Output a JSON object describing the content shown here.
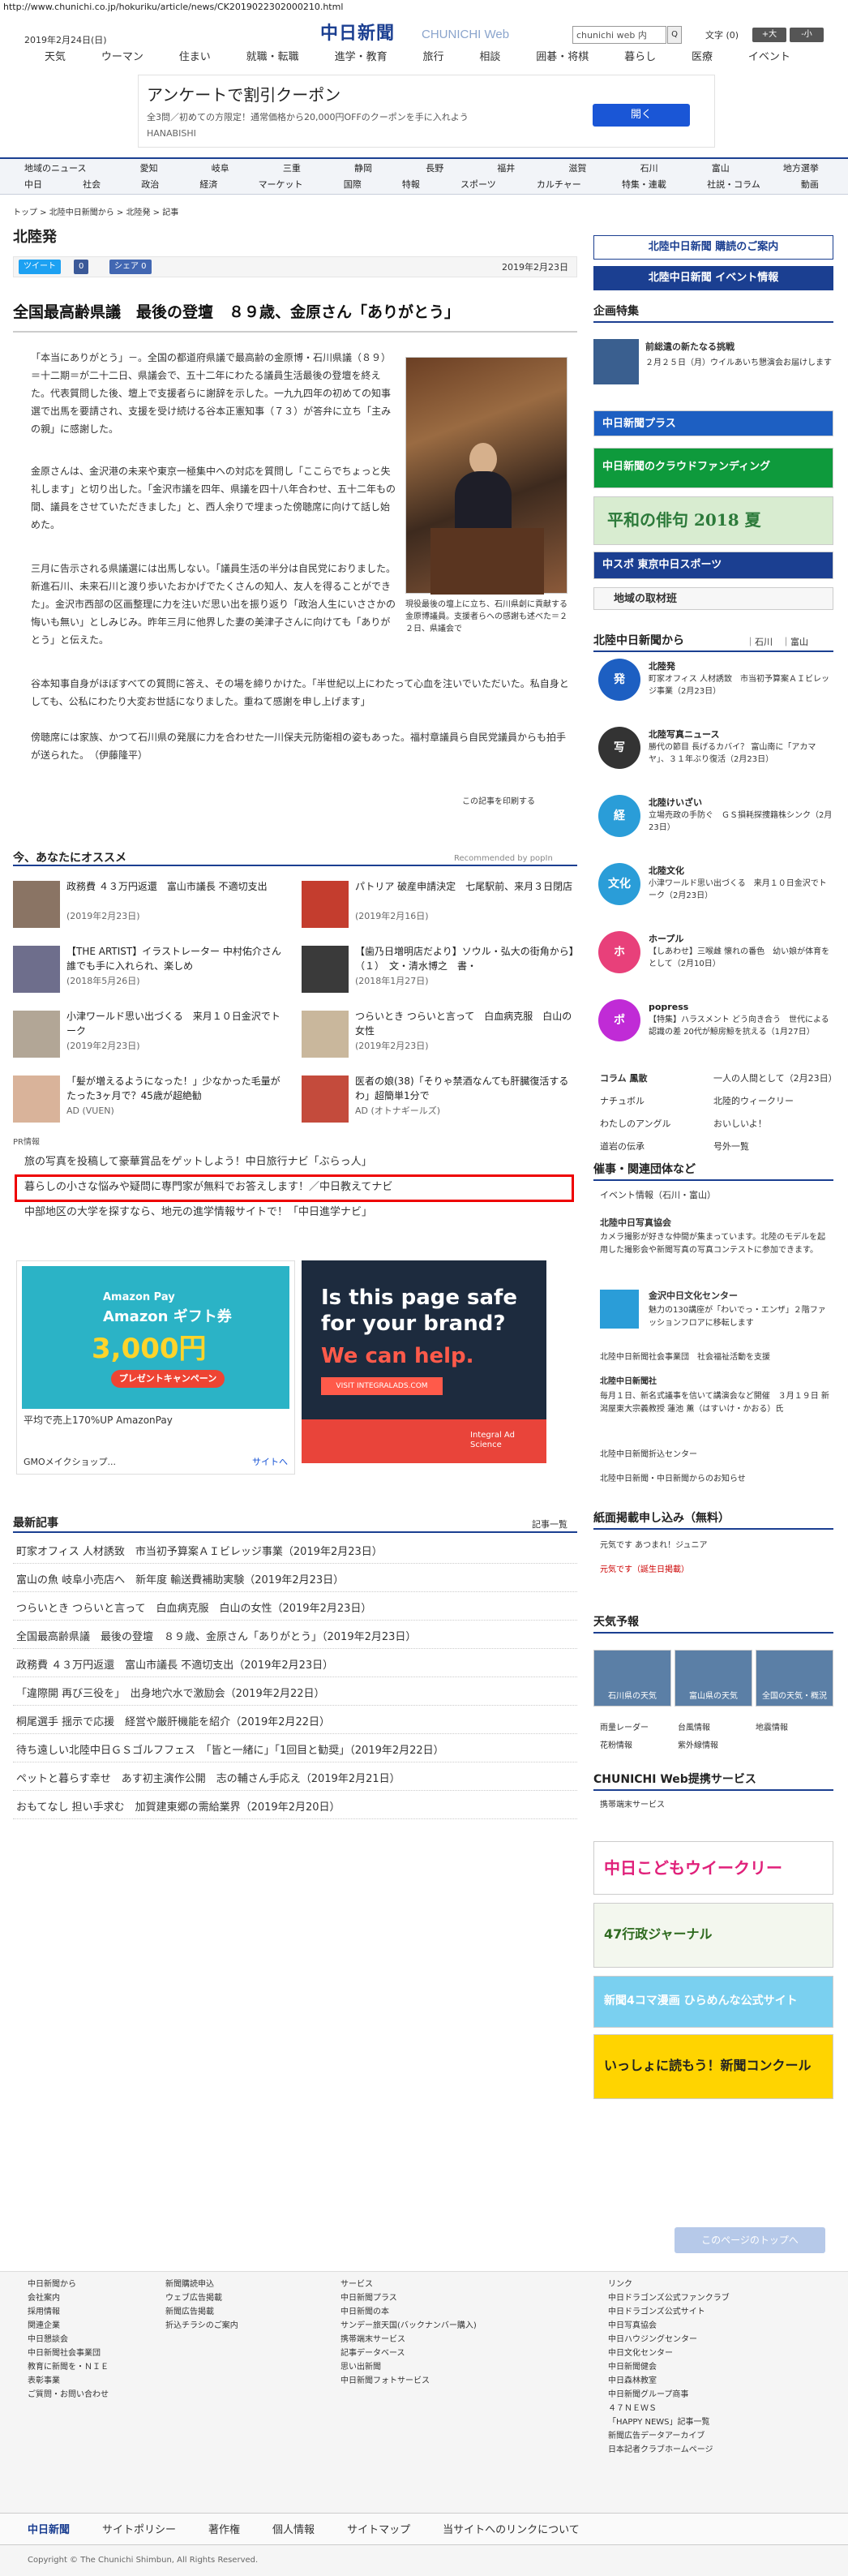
{
  "url": "http://www.chunichi.co.jp/hokuriku/article/news/CK2019022302000210.html",
  "header": {
    "date": "2019年2月24日(日)",
    "logo": "中日新聞",
    "logo_sub": "CHUNICHI Web",
    "search_placeholder": "chunichi web 内",
    "search_btn": "Q",
    "font_label": "文字 (0)",
    "font_up": "+大",
    "font_down": "-小"
  },
  "topnav": [
    "天気",
    "ウーマン",
    "住まい",
    "就職・転職",
    "進学・教育",
    "旅行",
    "相談",
    "囲碁・将棋",
    "暮らし",
    "医療",
    "イベント"
  ],
  "ad_top": {
    "title": "アンケートで割引クーポン",
    "sub": "全3問／初めての方限定！通常価格から20,000円OFFのクーポンを手に入れよう",
    "advertiser": "HANABISHI",
    "button": "開く"
  },
  "catnav_row1": [
    "地域のニュース",
    "愛知",
    "岐阜",
    "三重",
    "静岡",
    "長野",
    "福井",
    "滋賀",
    "石川",
    "富山",
    "地方選挙"
  ],
  "catnav_row2": [
    "中日",
    "社会",
    "政治",
    "経済",
    "マーケット",
    "国際",
    "特報",
    "スポーツ",
    "カルチャー",
    "特集・連載",
    "社説・コラム",
    "動画"
  ],
  "breadcrumb": "トップ > 北陸中日新聞から > 北陸発 > 記事",
  "region_title": "北陸発",
  "share": {
    "tweet": "ツイート",
    "like": "0",
    "share": "シェア 0"
  },
  "article": {
    "date": "2019年2月23日",
    "headline": "全国最高齢県議　最後の登壇　８９歳、金原さん「ありがとう」",
    "p1": "「本当にありがとう」－。全国の都道府県議で最高齢の金原博・石川県議（８９）＝十二期＝が二十二日、県議会で、五十二年にわたる議員生活最後の登壇を終えた。代表質問した後、壇上で支援者らに謝辞を示した。一九九四年の初めての知事選で出馬を要請され、支援を受け続ける谷本正憲知事（７３）が答弁に立ち「主みの親」に感謝した。",
    "p2": "金原さんは、金沢港の未来や東京一極集中への対応を質問し「ここらでちょっと失礼します」と切り出した。「金沢市議を四年、県議を四十八年合わせ、五十二年もの間、議員をさせていただきました」と、西人余りで埋まった傍聴席に向けて話し始めた。",
    "p3": "三月に告示される県議選には出馬しない。「議員生活の半分は自民党におりました。新進石川、未来石川と渡り歩いたおかげでたくさんの知人、友人を得ることができた」。金沢市西部の区画整理に力を注いだ思い出を振り返り「政治人生にいささかの悔いも無い」としみじみ。昨年三月に他界した妻の美津子さんに向けても「ありがとう」と伝えた。",
    "p4": "谷本知事自身がほぼすべての質問に答え、その場を締りかけた。「半世紀以上にわたって心血を注いでいただいた。私自身としても、公私にわたり大変お世話になりました。重ねて感謝を申し上げます」",
    "p5": "傍聴席には家族、かつて石川県の発展に力を合わせた一川保夫元防衛相の姿もあった。福村章議員ら自民党議員からも拍手が送られた。　（伊藤隆平）",
    "caption": "現役最後の壇上に立ち、石川県創に貢献する金原博議員。支援者らへの感謝も述べた＝２２日、県議会で",
    "print": "この記事を印刷する"
  },
  "recommend": {
    "title": "今、あなたにオススメ",
    "by": "Recommended by popIn",
    "items": [
      {
        "t": "政務費 ４３万円返還　富山市議長 不適切支出",
        "d": "(2019年2月23日)"
      },
      {
        "t": "パトリア 破産申請決定　七尾駅前、来月３日閉店",
        "d": "(2019年2月16日)"
      },
      {
        "t": "【THE ARTIST】イラストレーター 中村佑介さん　誰でも手に入れられ、楽しめ",
        "d": "(2018年5月26日)"
      },
      {
        "t": "【歯乃日増明店だより】ソウル・弘大の街角から】（１）　文・清水博之　書・",
        "d": "(2018年1月27日)"
      },
      {
        "t": "小津ワールド思い出づくる　来月１０日金沢でトーク",
        "d": "(2019年2月23日)"
      },
      {
        "t": "つらいとき つらいと言って　白血病克服　白山の女性",
        "d": "(2019年2月23日)"
      },
      {
        "t": "「髪が増えるようになった！」少なかった毛量がたった3ヶ月で？45歳が超絶勧",
        "d": "AD (VUEN)"
      },
      {
        "t": "医者の娘(38)「そりゃ禁酒なんても肝臓復活するわ」超簡単1分で",
        "d": "AD (オトナギールズ)"
      }
    ]
  },
  "pr": {
    "label": "PR情報",
    "links": [
      "旅の写真を投稿して豪華賞品をゲットしよう！中日旅行ナビ「ぶらっ人」",
      "暮らしの小さな悩みや疑問に専門家が無料でお答えします！／中日教えてナビ",
      "中部地区の大学を探すなら、地元の進学情報サイトで！「中日進学ナビ」"
    ]
  },
  "ad_amazon": {
    "amz": "Amazon Pay",
    "gift": "Amazon ギフト券",
    "amount": "3,000円",
    "cta": "プレゼントキャンペーン",
    "sub": "平均で売上170%UP AmazonPay",
    "gmo": "GMOメイクショップ...",
    "site": "サイトへ"
  },
  "ad_ias": {
    "l1a": "Is this page safe",
    "l1b": "for your brand?",
    "l2": "We can help.",
    "btn": "VISIT INTEGRALADS.COM",
    "brand": "Integral Ad Science"
  },
  "latest": {
    "title": "最新記事",
    "all": "記事一覧",
    "items": [
      "町家オフィス 人材誘致　市当初予算案ＡＩビレッジ事業（2019年2月23日）",
      "富山の魚 岐阜小売店へ　新年度 輸送費補助実験（2019年2月23日）",
      "つらいとき つらいと言って　白血病克服　白山の女性（2019年2月23日）",
      "全国最高齢県議　最後の登壇　８９歳、金原さん「ありがとう」（2019年2月23日）",
      "政務費 ４３万円返還　富山市議長 不適切支出（2019年2月23日）",
      "「違際開 再び三役を」　出身地穴水で激励会（2019年2月22日）",
      "桐尾選手 揺示で応援　経営や厳肝機能を紹介（2019年2月22日）",
      "待ち遠しい北陸中日ＧＳゴルフフェス　「皆と一緒に」「1回目と勧奨」（2019年2月22日）",
      "ペットと暮らす幸せ　あす初主演作公開　志の輔さん手応え（2019年2月21日）",
      "おもてなし 担い手求む　加賀建東郷の需給業界（2019年2月20日）"
    ]
  },
  "sidebar": {
    "subscribe": "北陸中日新聞 購読のご案内",
    "event": "北陸中日新聞 イベント情報",
    "kikaku": "企画特集",
    "feature_t": "前総遺の新たなる挑戦",
    "feature_d": "２月２５日（月）ウイルあいち懇演会お届けします",
    "ban1": "中日新聞プラス",
    "ban2": "中日新聞のクラウドファンディング",
    "ban3": "平和の俳句 2018 夏",
    "ban4": "中スポ 東京中日スポーツ",
    "region_link": "地域の取材班",
    "hk_title": "北陸中日新聞から",
    "hk_tabs": "｜石川　｜富山",
    "entries": [
      {
        "icon": "発",
        "t": "北陸発",
        "d": "町家オフィス 人材誘致　市当初予算案ＡＩビレッジ事業（2月23日）"
      },
      {
        "icon": "写",
        "t": "北陸写真ニュース",
        "d": "勝代の節目 長げるカバイ？ 富山南に「アカマヤ」、３１年ぶり復活（2月23日）"
      },
      {
        "icon": "経",
        "t": "北陸けいざい",
        "d": "立場売政の手防ぐ　ＧＳ損耗探捜籍株シンク（2月23日）"
      },
      {
        "icon": "文化",
        "t": "北陸文化",
        "d": "小津ワールド思い出づくる　来月１０日金沢でトーク（2月23日）"
      },
      {
        "icon": "ホ",
        "t": "ホープル",
        "d": "【しあわせ】三喉雌 懐れの番色　幼い娘が体育をとして（2月10日）"
      },
      {
        "icon": "ポ",
        "t": "popress",
        "d": "【特集】ハラスメント どう向き合う　世代による認識の差 20代が鯨房鯨を抗える（1月27日）"
      }
    ],
    "links": [
      "コラム 鳳散",
      "一人の人間として（2月23日）",
      "ナチュボル",
      "北陸的ウィークリー",
      "わたしのアングル",
      "おいしいよ！",
      "道岩の伝承",
      "号外一覧"
    ],
    "saiji": "催事・関連団体など",
    "ev_link": "イベント情報（石川・富山）",
    "photo_t": "北陸中日写真協会",
    "photo_d": "カメラ撮影が好きな仲間が集まっています。北陸のモデルを起用した撮影会や新聞写真の写真コンテストに参加できます。",
    "kanazawa_t": "金沢中日文化センター",
    "kanazawa_d": "魅力の130講座が「わいでっ・エンザ」２階ファッションフロアに移転します",
    "soc1": "北陸中日新聞社会事業団　社会福祉活動を支援",
    "fuku_t": "北陸中日新聞社",
    "fuku_d": "毎月１日、新名式議事を信いて講演会など開催　３月１９日 新潟屋東大宗義教授 蓮池 薫（はすいけ・かおる）氏",
    "soc2": "北陸中日新聞折込センター",
    "soc3": "北陸中日新聞・中日新聞からのお知らせ",
    "keisai": "紙面掲載申し込み（無料）",
    "keisai1": "元気です あつまれ！ジュニア",
    "keisai2": "元気です（誕生日掲載）",
    "weather": "天気予報",
    "wx1": "石川県の天気",
    "wx2": "富山県の天気",
    "wx3": "全国の天気・概況",
    "wlinks": [
      "雨量レーダー",
      "台風情報",
      "地震情報",
      "花粉情報",
      "紫外線情報"
    ],
    "svc": "CHUNICHI Web提携サービス",
    "svc1": "携帯端末サービス",
    "kids1": "中日こどもウイークリー",
    "kids2": "47行政ジャーナル",
    "kids3": "新聞4コマ漫画 ひらめんな公式サイト",
    "kids4": "いっしょに読もう！新聞コンクール"
  },
  "footer": {
    "totop": "このページのトップへ",
    "col1": [
      "中日新聞から",
      "会社案内",
      "採用情報",
      "関連企業",
      "中日懇談会",
      "中日新聞社会事業団",
      "教育に新聞を・ＮＩＥ",
      "表彰事業",
      "ご質問・お問い合わせ"
    ],
    "col2": [
      "",
      "新聞購読申込",
      "ウェブ広告掲載",
      "新聞広告掲載",
      "折込チラシのご案内"
    ],
    "col3": [
      "サービス",
      "中日新聞プラス",
      "中日新聞の本",
      "サンデー旅天国(バックナンバー購入)",
      "携帯端末サービス",
      "記事データベース",
      "思い出新聞",
      "中日新聞フォトサービス"
    ],
    "col4": [
      "リンク",
      "中日ドラゴンズ公式ファンクラブ",
      "中日ドラゴンズ公式サイト",
      "中日写真協会",
      "中日ハウジングセンター",
      "中日文化センター",
      "中日新聞健会",
      "中日森林教室",
      "中日新聞グループ商事",
      "４７ＮＥＷＳ",
      "「HAPPY NEWS」記事一覧",
      "新聞広告データアーカイブ",
      "日本記者クラブホームページ"
    ],
    "bar": [
      "中日新聞",
      "サイトポリシー",
      "著作権",
      "個人情報",
      "サイトマップ",
      "当サイトへのリンクについて"
    ],
    "copy": "Copyright © The Chunichi Shimbun, All Rights Reserved."
  }
}
